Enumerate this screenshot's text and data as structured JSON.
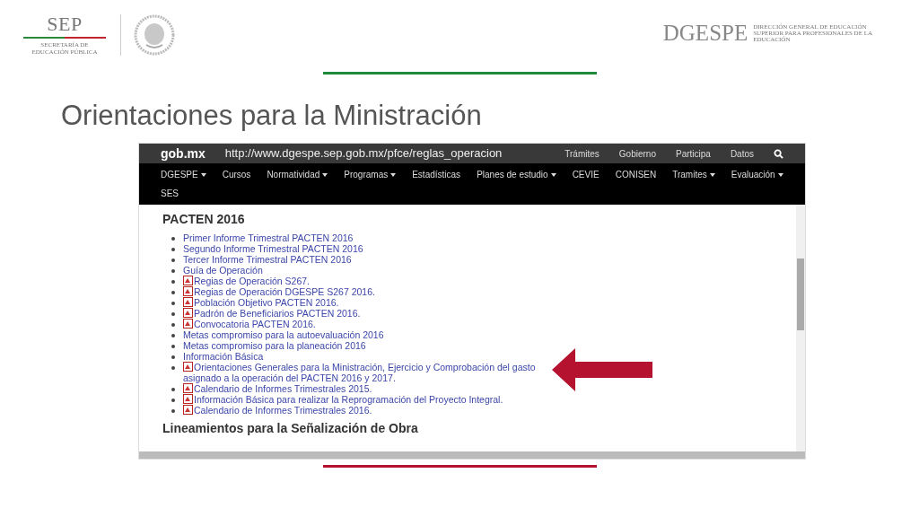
{
  "header": {
    "sep": {
      "name": "SEP",
      "subtitle": [
        "SECRETARÍA DE",
        "EDUCACIÓN PÚBLICA"
      ]
    },
    "dgespe": {
      "name": "DGESPE",
      "subtitle": [
        "DIRECCIÓN GENERAL DE EDUCACIÓN",
        "SUPERIOR PARA PROFESIONALES DE LA",
        "EDUCACIÓN"
      ]
    }
  },
  "title": "Orientaciones para la Ministración",
  "browser": {
    "brand": "gob.mx",
    "url": "http://www.dgespe.sep.gob.mx/pfce/reglas_operacion",
    "top_links": [
      "Trámites",
      "Gobierno",
      "Participa",
      "Datos"
    ],
    "nav": [
      {
        "label": "DGESPE",
        "has_menu": true
      },
      {
        "label": "Cursos",
        "has_menu": false
      },
      {
        "label": "Normatividad",
        "has_menu": true
      },
      {
        "label": "Programas",
        "has_menu": true
      },
      {
        "label": "Estadísticas",
        "has_menu": false
      },
      {
        "label": "Planes de estudio",
        "has_menu": true
      },
      {
        "label": "CEVIE",
        "has_menu": false
      },
      {
        "label": "CONISEN",
        "has_menu": false
      },
      {
        "label": "Tramites",
        "has_menu": true
      },
      {
        "label": "Evaluación",
        "has_menu": true
      },
      {
        "label": "SES",
        "has_menu": false
      }
    ],
    "heading": "PACTEN 2016",
    "items": [
      {
        "kind": "link",
        "text": "Primer Informe Trimestral PACTEN 2016"
      },
      {
        "kind": "link",
        "text": "Segundo Informe Trimestral PACTEN 2016"
      },
      {
        "kind": "link",
        "text": "Tercer Informe Trimestral PACTEN 2016"
      },
      {
        "kind": "link",
        "text": "Guía de Operación"
      },
      {
        "kind": "pdf",
        "text": "Regias de Operación S267."
      },
      {
        "kind": "pdf",
        "text": "Regias de Operación DGESPE S267 2016."
      },
      {
        "kind": "pdf",
        "text": "Población Objetivo PACTEN 2016."
      },
      {
        "kind": "pdf",
        "text": "Padrón de Beneficiarios PACTEN 2016."
      },
      {
        "kind": "pdf",
        "text": "Convocatoria PACTEN 2016."
      },
      {
        "kind": "link",
        "text": "Metas compromiso para la autoevaluación 2016"
      },
      {
        "kind": "link",
        "text": "Metas compromiso para la planeación 2016"
      },
      {
        "kind": "link",
        "text": "Información Básica"
      },
      {
        "kind": "pdf",
        "text": "Orientaciones Generales para la Ministración, Ejercicio y Comprobación del gasto asignado a la operación del PACTEN 2016 y 2017."
      },
      {
        "kind": "pdf",
        "text": "Calendario de Informes Trimestrales 2015."
      },
      {
        "kind": "pdf",
        "text": "Información Básica para realizar la Reprogramación del Proyecto Integral."
      },
      {
        "kind": "pdf",
        "text": "Calendario de Informes Trimestrales 2016."
      }
    ],
    "next_heading": "Lineamientos para la Señalización de Obra"
  }
}
